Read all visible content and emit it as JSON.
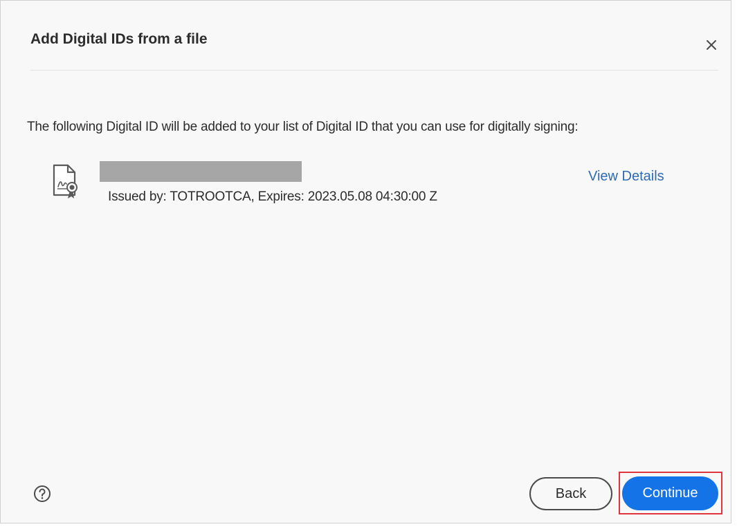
{
  "dialog": {
    "title": "Add Digital IDs from a file",
    "close_icon": "close-icon",
    "intro_text": "The following Digital ID will be added to your list of Digital ID that you can use for digitally signing:"
  },
  "digital_id": {
    "icon": "certificate-document-icon",
    "name_redacted": true,
    "issued_text": "Issued by: TOTROOTCA, Expires: 2023.05.08 04:30:00 Z",
    "view_details_label": "View Details"
  },
  "footer": {
    "help_icon": "help-icon",
    "back_label": "Back",
    "continue_label": "Continue"
  },
  "colors": {
    "primary_button": "#1473e6",
    "link": "#2d6bb5",
    "highlight_box": "#e0353d",
    "redaction": "#a6a6a6"
  }
}
